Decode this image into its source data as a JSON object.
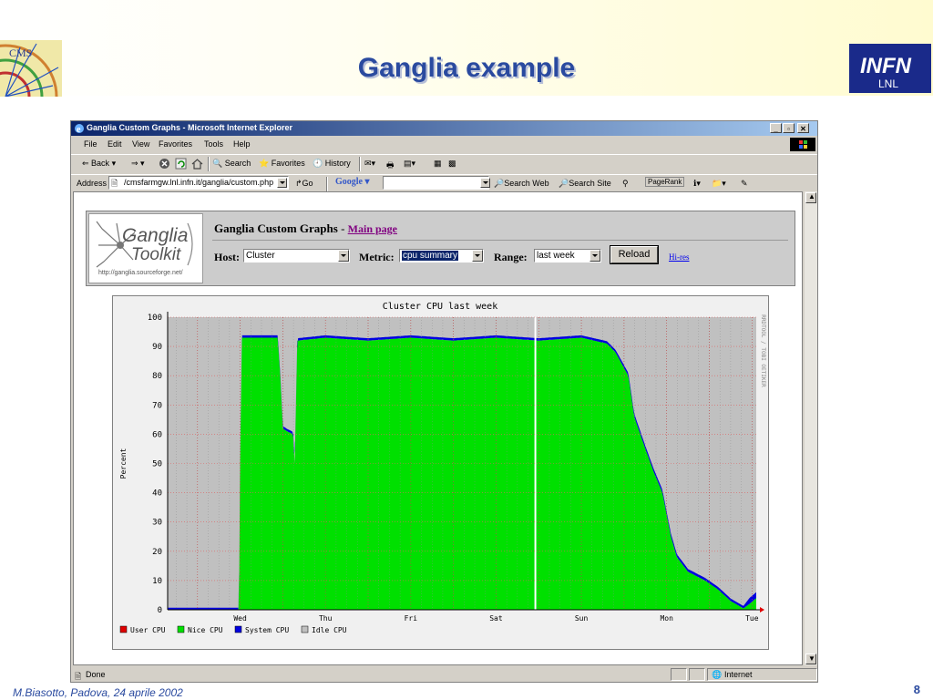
{
  "slide": {
    "title": "Ganglia example",
    "footer_left": "M.Biasotto, Padova, 24 aprile 2002",
    "page_number": "8",
    "cms_logo_text": "CMS",
    "infn_logo_text": "INFN",
    "infn_logo_sub": "LNL"
  },
  "browser": {
    "window_title": "Ganglia Custom Graphs - Microsoft Internet Explorer",
    "menu": [
      "File",
      "Edit",
      "View",
      "Favorites",
      "Tools",
      "Help"
    ],
    "toolbar": {
      "back": "Back",
      "search": "Search",
      "favorites": "Favorites",
      "history": "History"
    },
    "address_label": "Address",
    "address_value": "/cmsfarmgw.lnl.infn.it/ganglia/custom.php",
    "go_label": "Go",
    "google_label": "Google",
    "search_web": "Search Web",
    "search_site": "Search Site",
    "pagerank": "PageRank",
    "status_text": "Done",
    "zone_text": "Internet"
  },
  "ganglia": {
    "logo_line1": "Ganglia",
    "logo_line2": "Toolkit",
    "logo_url": "http://ganglia.sourceforge.net/",
    "page_title": "Ganglia Custom Graphs",
    "separator": "-",
    "main_page_link": "Main page",
    "host_label": "Host:",
    "host_value": "Cluster",
    "metric_label": "Metric:",
    "metric_value": "cpu summary",
    "range_label": "Range:",
    "range_value": "last week",
    "reload_label": "Reload",
    "hires_label": "Hi-res"
  },
  "chart_data": {
    "type": "area",
    "title": "Cluster CPU last week",
    "ylabel": "Percent",
    "xlabel": "",
    "ylim": [
      0,
      100
    ],
    "yticks": [
      0,
      10,
      20,
      30,
      40,
      50,
      60,
      70,
      80,
      90,
      100
    ],
    "xtick_labels": [
      "Wed",
      "Thu",
      "Fri",
      "Sat",
      "Sun",
      "Mon",
      "Tue"
    ],
    "xlim": [
      -0.85,
      6.05
    ],
    "side_label": "RRDTOOL / TOBI OETIKER",
    "stacked": true,
    "grid": true,
    "legend_position": "bottom-left",
    "series": [
      {
        "name": "User CPU",
        "color": "#e00000",
        "points": [
          [
            -0.85,
            0
          ],
          [
            6.05,
            0
          ]
        ]
      },
      {
        "name": "Nice CPU",
        "color": "#00e000",
        "points": [
          [
            -0.85,
            0
          ],
          [
            -0.02,
            0
          ],
          [
            -0.01,
            13
          ],
          [
            0.0,
            51
          ],
          [
            0.02,
            93
          ],
          [
            0.44,
            93
          ],
          [
            0.47,
            80
          ],
          [
            0.5,
            62
          ],
          [
            0.55,
            61
          ],
          [
            0.62,
            60
          ],
          [
            0.64,
            50
          ],
          [
            0.67,
            92
          ],
          [
            1.0,
            93
          ],
          [
            1.5,
            92
          ],
          [
            2.0,
            93
          ],
          [
            2.5,
            92
          ],
          [
            3.0,
            93
          ],
          [
            3.5,
            92
          ],
          [
            4.0,
            93
          ],
          [
            4.3,
            91
          ],
          [
            4.4,
            88
          ],
          [
            4.55,
            80
          ],
          [
            4.62,
            66
          ],
          [
            4.75,
            55
          ],
          [
            4.85,
            47
          ],
          [
            4.95,
            40
          ],
          [
            5.05,
            25
          ],
          [
            5.12,
            18
          ],
          [
            5.25,
            13
          ],
          [
            5.45,
            10
          ],
          [
            5.6,
            7
          ],
          [
            5.75,
            3
          ],
          [
            5.9,
            0.5
          ],
          [
            5.97,
            2
          ],
          [
            6.05,
            4
          ]
        ]
      },
      {
        "name": "System CPU",
        "color": "#0000e0",
        "points": [
          [
            -0.85,
            0.7
          ],
          [
            -0.02,
            0.7
          ],
          [
            0.0,
            0.8
          ],
          [
            0.44,
            0.8
          ],
          [
            0.67,
            0.8
          ],
          [
            4.3,
            0.8
          ],
          [
            4.62,
            1
          ],
          [
            5.0,
            1
          ],
          [
            5.9,
            0.8
          ],
          [
            5.97,
            2
          ],
          [
            6.05,
            2
          ]
        ]
      },
      {
        "name": "Idle CPU",
        "color": "#c0c0c0",
        "points": [
          [
            -0.85,
            100
          ],
          [
            6.05,
            100
          ]
        ]
      }
    ]
  }
}
